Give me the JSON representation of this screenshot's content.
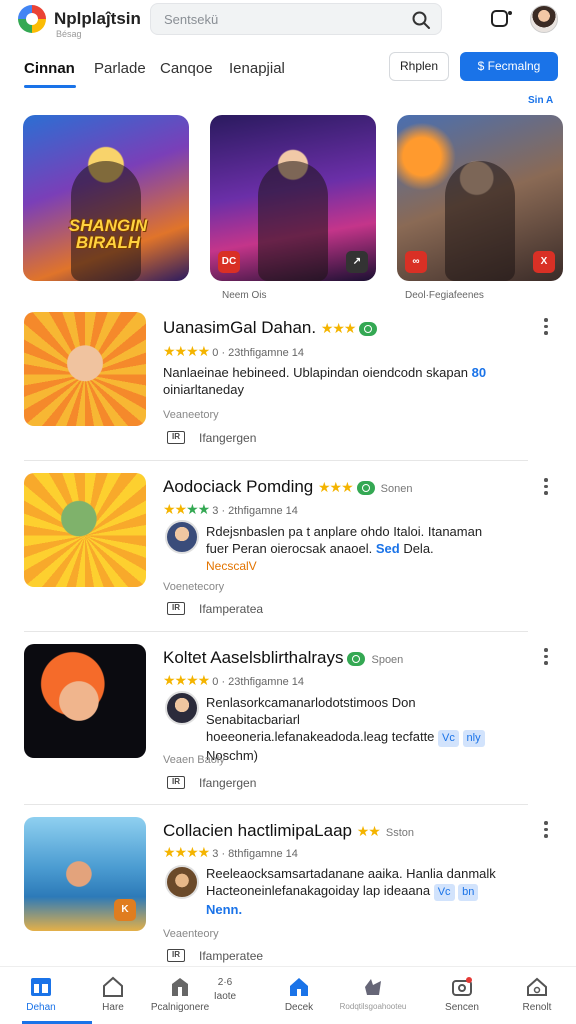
{
  "header": {
    "app_name": "Nplplaĵtsin",
    "app_sub": "Bésag",
    "search_placeholder": "Sentsekü"
  },
  "tabs": [
    {
      "label": "Cinnan",
      "active": true
    },
    {
      "label": "Parlade",
      "active": false
    },
    {
      "label": "Canqoe",
      "active": false
    },
    {
      "label": "Ienapjial",
      "active": false
    }
  ],
  "actions": {
    "outline_label": "Rhplen",
    "primary_label": "$ Fecmalng",
    "see_all": "Sin A"
  },
  "featured": [
    {
      "title": "SHANGIN BIRALH",
      "badge": "",
      "theme": "orange-blue"
    },
    {
      "title": "",
      "badge": "DC",
      "theme": "purple"
    },
    {
      "title": "",
      "badge": "X",
      "theme": "fire"
    }
  ],
  "featured_captions": [
    "Neem Ois",
    "Deol·Fegiafeenes"
  ],
  "list": [
    {
      "title": "UanasimGal Dahan.",
      "rating_line": "0 · 23thfigamne 14",
      "desc": "Nanlaeinae hebineed. Ublapindan oiendcodn skapan",
      "desc_link": "80",
      "desc_line2": "oiniarltaneday",
      "sub": "Veaneetory",
      "lang_icon": "IR",
      "lang": "Ifangergen"
    },
    {
      "title": "Aodociack Pomding",
      "meta": "Sonen",
      "rating_line": "3 · 2thfigamne 14",
      "desc": "Rdejsnbaslen pa t anplare ohdo Italoi. Itanaman",
      "desc_line2": "fuer Peran oierocsak anaoel.",
      "desc_link": "Sed",
      "desc_end": "Dela.",
      "orange": "NecscalV",
      "sub": "Voenetecory",
      "lang_icon": "IR",
      "lang": "Ifamperatea"
    },
    {
      "title": "Koltet Aaselsblirthalrays",
      "meta": "Spoen",
      "rating_line": "0 · 23thfigamne 14",
      "desc": "Renlasorkcamanarlodotstimoos Don Senabitacbariarl",
      "desc_line2": "hoeeoneria.lefanakeadoda.leag tecfatte",
      "chip": "Vc",
      "chip2": "nly",
      "desc_line3": "Noschm)",
      "sub": "Veaen Baoly",
      "lang_icon": "IR",
      "lang": "Ifangergen"
    },
    {
      "title": "Collacien hactlimipaLaap",
      "meta": "Sston",
      "rating_line": "3 · 8thfigamne 14",
      "desc": "Reeleaocksamsartadanane aaika. Hanlia danmalk",
      "desc_line2": "Hacteoneinlefanakagoiday lap ideaana",
      "chip": "Vc",
      "chip2": "bn",
      "desc_line3": "Nenn.",
      "sub": "Veaenteory",
      "lang_icon": "IR",
      "lang": "Ifamperatee",
      "badge": "K"
    }
  ],
  "bottom_nav": [
    {
      "label": "Dehan",
      "active": true
    },
    {
      "label": "Hare"
    },
    {
      "label": "Pcalnigonere"
    },
    {
      "label": "Iaote",
      "top": "2·6"
    },
    {
      "label": "Decek"
    },
    {
      "label": "Rodqtilsgoahooteu"
    },
    {
      "label": "Sencen"
    },
    {
      "label": "Renolt"
    }
  ]
}
